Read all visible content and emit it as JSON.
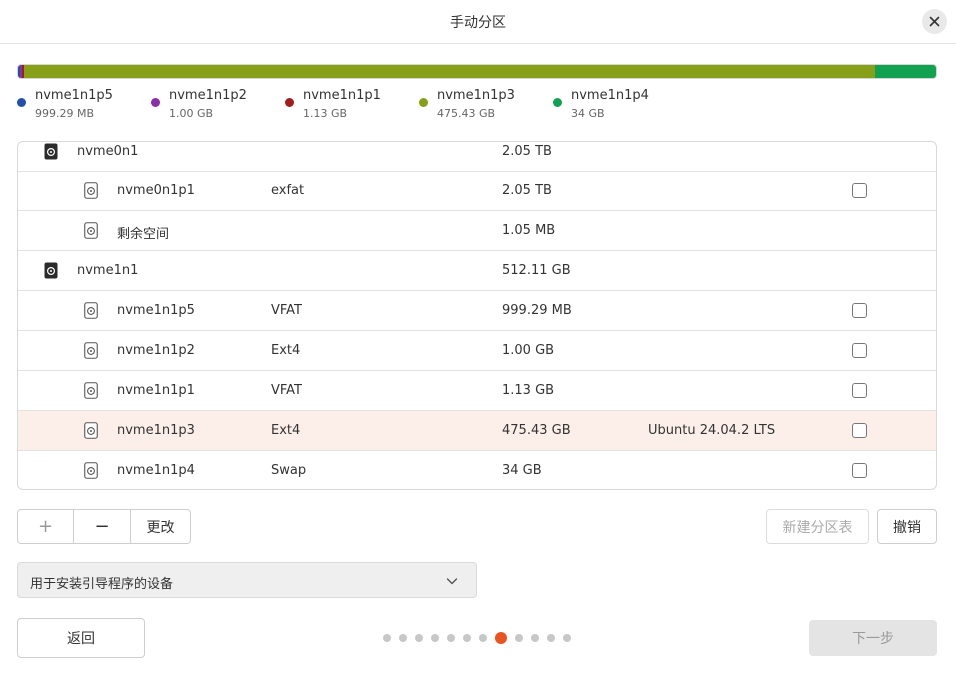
{
  "window": {
    "title": "手动分区",
    "close_icon": "close-icon"
  },
  "usage_bar": {
    "segments": [
      {
        "name": "nvme1n1p5",
        "size_gb": 0.999,
        "color": "#2151a8"
      },
      {
        "name": "nvme1n1p2",
        "size_gb": 1.0,
        "color": "#8c2daa"
      },
      {
        "name": "nvme1n1p1",
        "size_gb": 1.13,
        "color": "#a31d1d"
      },
      {
        "name": "nvme1n1p3",
        "size_gb": 475.43,
        "color": "#86a018"
      },
      {
        "name": "nvme1n1p4",
        "size_gb": 34,
        "color": "#12a150"
      }
    ]
  },
  "legend": [
    {
      "name": "nvme1n1p5",
      "size": "999.29 MB",
      "color": "#2151a8"
    },
    {
      "name": "nvme1n1p2",
      "size": "1.00 GB",
      "color": "#8c2daa"
    },
    {
      "name": "nvme1n1p1",
      "size": "1.13 GB",
      "color": "#a31d1d"
    },
    {
      "name": "nvme1n1p3",
      "size": "475.43 GB",
      "color": "#86a018"
    },
    {
      "name": "nvme1n1p4",
      "size": "34 GB",
      "color": "#12a150"
    }
  ],
  "partitions": [
    {
      "kind": "disk",
      "name": "nvme0n1",
      "fs": "",
      "size": "2.05 TB",
      "system": "",
      "checkbox": false,
      "selected": false,
      "icon": "disk-icon"
    },
    {
      "kind": "partition",
      "name": "nvme0n1p1",
      "fs": "exfat",
      "size": "2.05 TB",
      "system": "",
      "checkbox": true,
      "selected": false,
      "icon": "partition-icon"
    },
    {
      "kind": "partition",
      "name": "剩余空间",
      "fs": "",
      "size": "1.05 MB",
      "system": "",
      "checkbox": false,
      "selected": false,
      "icon": "partition-icon"
    },
    {
      "kind": "disk",
      "name": "nvme1n1",
      "fs": "",
      "size": "512.11 GB",
      "system": "",
      "checkbox": false,
      "selected": false,
      "icon": "disk-icon"
    },
    {
      "kind": "partition",
      "name": "nvme1n1p5",
      "fs": "VFAT",
      "size": "999.29 MB",
      "system": "",
      "checkbox": true,
      "selected": false,
      "icon": "partition-icon"
    },
    {
      "kind": "partition",
      "name": "nvme1n1p2",
      "fs": "Ext4",
      "size": "1.00 GB",
      "system": "",
      "checkbox": true,
      "selected": false,
      "icon": "partition-icon"
    },
    {
      "kind": "partition",
      "name": "nvme1n1p1",
      "fs": "VFAT",
      "size": "1.13 GB",
      "system": "",
      "checkbox": true,
      "selected": false,
      "icon": "partition-icon"
    },
    {
      "kind": "partition",
      "name": "nvme1n1p3",
      "fs": "Ext4",
      "size": "475.43 GB",
      "system": "Ubuntu 24.04.2 LTS",
      "checkbox": true,
      "selected": true,
      "icon": "partition-icon"
    },
    {
      "kind": "partition",
      "name": "nvme1n1p4",
      "fs": "Swap",
      "size": "34 GB",
      "system": "",
      "checkbox": true,
      "selected": false,
      "icon": "partition-icon"
    }
  ],
  "toolbar": {
    "add_label": "+",
    "remove_label": "−",
    "change_label": "更改",
    "new_table_label": "新建分区表",
    "revert_label": "撤销"
  },
  "bootloader": {
    "label": "用于安装引导程序的设备"
  },
  "footer": {
    "back_label": "返回",
    "next_label": "下一步",
    "page_total": 12,
    "page_current": 8
  },
  "colors": {
    "accent": "#e95420",
    "selected_row": "#fcefe9"
  }
}
